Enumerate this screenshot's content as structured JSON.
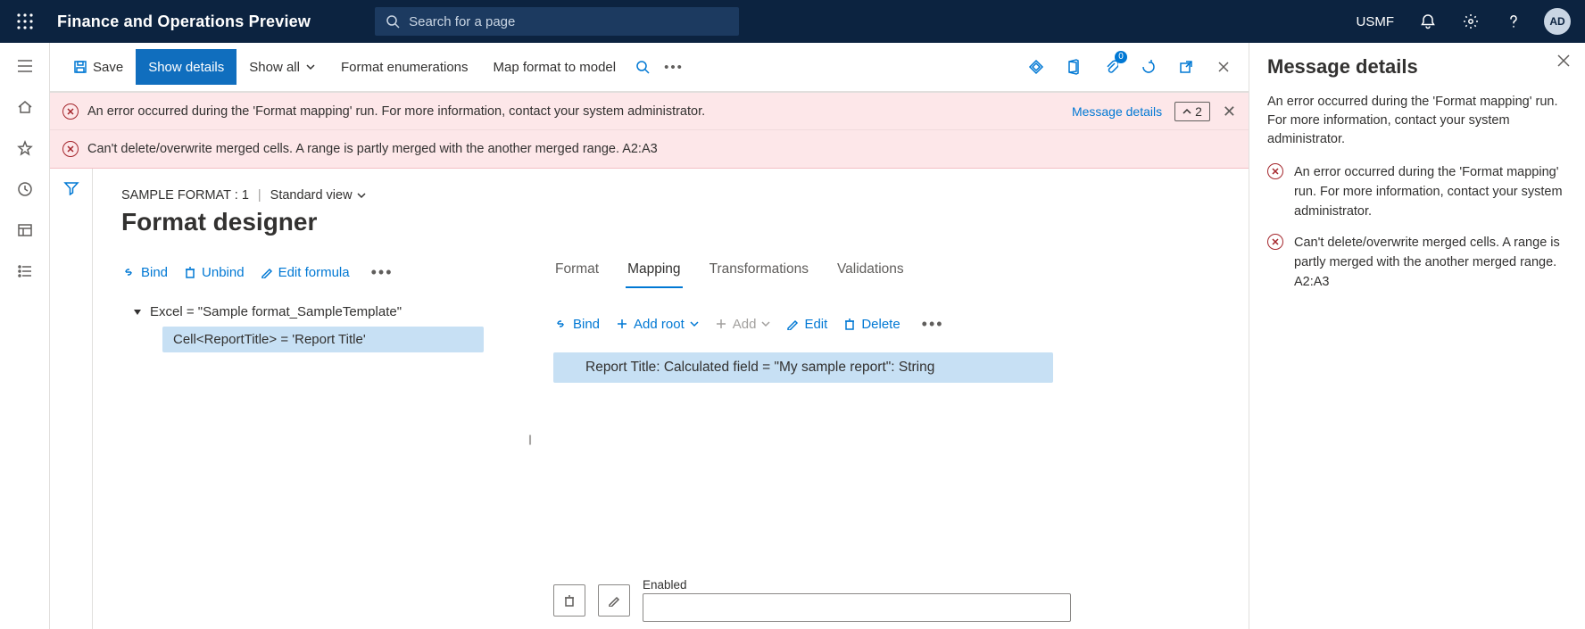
{
  "topbar": {
    "title": "Finance and Operations Preview",
    "search_placeholder": "Search for a page",
    "entity": "USMF",
    "avatar": "AD"
  },
  "actionbar": {
    "save": "Save",
    "show_details": "Show details",
    "show_all": "Show all",
    "format_enum": "Format enumerations",
    "map_format": "Map format to model",
    "attach_count": "0"
  },
  "banner": {
    "msg1": "An error occurred during the 'Format mapping' run. For more information, contact your system administrator.",
    "msg2": "Can't delete/overwrite merged cells. A range is partly merged with the another merged range. A2:A3",
    "details_link": "Message details",
    "count": "2"
  },
  "designer": {
    "crumb": "SAMPLE FORMAT : 1",
    "view": "Standard view",
    "title": "Format designer",
    "left_tools": {
      "bind": "Bind",
      "unbind": "Unbind",
      "edit_formula": "Edit formula"
    },
    "tree_root": "Excel = \"Sample format_SampleTemplate\"",
    "tree_child": "Cell<ReportTitle> = 'Report Title'",
    "tabs": {
      "format": "Format",
      "mapping": "Mapping",
      "transform": "Transformations",
      "valid": "Validations"
    },
    "right_tools": {
      "bind": "Bind",
      "add_root": "Add root",
      "add": "Add",
      "edit": "Edit",
      "delete": "Delete"
    },
    "mapping_item": "Report Title: Calculated field = \"My sample report\": String",
    "enabled_label": "Enabled"
  },
  "rightpanel": {
    "title": "Message details",
    "summary": "An error occurred during the 'Format mapping' run. For more information, contact your system administrator.",
    "items": [
      "An error occurred during the 'Format mapping' run. For more information, contact your system administrator.",
      "Can't delete/overwrite merged cells. A range is partly merged with the another merged range. A2:A3"
    ]
  }
}
